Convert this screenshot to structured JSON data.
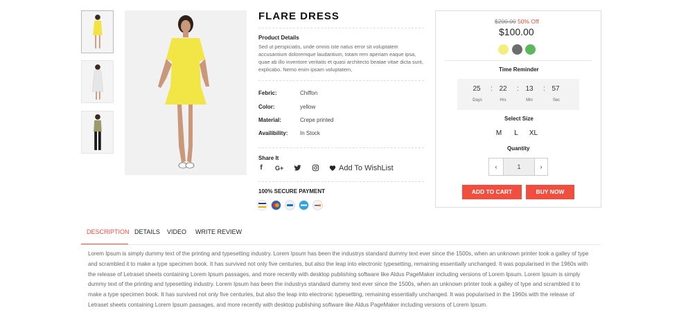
{
  "product": {
    "title": "FLARE DRESS",
    "details_heading": "Product Details",
    "description": "Sed ut perspiciatis, unde omnis iste natus error sit voluptatem accusantium doloremque laudantium, totam rem aperiam eaque ipsa, quae ab illo inventore veritatis et quasi architecto beatae vitae dicta sunt, explicabo. Nemo enim ipsam voluptatem,",
    "specs": [
      {
        "label": "Febric:",
        "value": "Chiffon"
      },
      {
        "label": "Color:",
        "value": "yellow"
      },
      {
        "label": "Material:",
        "value": "Crepe printed"
      },
      {
        "label": "Availibility:",
        "value": "In Stock"
      }
    ],
    "share_heading": "Share It",
    "share_icons": [
      "facebook-icon",
      "google-plus-icon",
      "twitter-icon",
      "instagram-icon"
    ],
    "share_glyphs": [
      "f",
      "G+",
      "",
      ""
    ],
    "wishlist_label": "Add To WishList",
    "payment_heading": "100% SECURE PAYMENT",
    "payment_icons": [
      "visa-icon",
      "mastercard-icon",
      "paypal-icon",
      "amex-icon",
      "discover-icon"
    ]
  },
  "purchase": {
    "old_price": "$200.00",
    "discount": "50% Off",
    "price": "$100.00",
    "colors": [
      "#f2ef7e",
      "#6d6d6d",
      "#5cb85c"
    ],
    "timer_heading": "Time Reminder",
    "timer": [
      {
        "value": "25",
        "label": "Days"
      },
      {
        "value": "22",
        "label": "Hrs"
      },
      {
        "value": "13",
        "label": "Min"
      },
      {
        "value": "57",
        "label": "Sec"
      }
    ],
    "size_heading": "Select Size",
    "sizes": [
      "M",
      "L",
      "XL"
    ],
    "quantity_heading": "Quantity",
    "quantity": "1",
    "qty_prev": "‹",
    "qty_next": "›",
    "add_to_cart": "ADD TO CART",
    "buy_now": "BUY NOW",
    "accent_color": "#f04e3e"
  },
  "tabs": {
    "items": [
      "DESCRIPTION",
      "DETAILS",
      "VIDEO",
      "WRITE REVIEW"
    ],
    "active": "DESCRIPTION",
    "content": "Lorem Ipsum is simply dummy text of the printing and typesetting industry. Lorem Ipsum has been the industrys standard dummy text ever since the 1500s, when an unknown printer took a galley of type and scrambled it to make a type specimen book. It has survived not only five centuries, but also the leap into electronic typesetting, remaining essentially unchanged. It was popularised in the 1960s with the release of Letraset sheets containing Lorem Ipsum passages, and more recently with desktop publishing software like Aldus PageMaker including versions of Lorem Ipsum. Lorem Ipsum is simply dummy text of the printing and typesetting industry. Lorem Ipsum has been the industrys standard dummy text ever since the 1500s, when an unknown printer took a galley of type and scrambled it to make a type specimen book. It has survived not only five centuries, but also the leap into electronic typesetting, remaining essentially unchanged. It was popularised in the 1960s with the release of Letraset sheets containing Lorem Ipsum passages, and more recently with desktop publishing software like Aldus PageMaker including versions of Lorem Ipsum."
  }
}
